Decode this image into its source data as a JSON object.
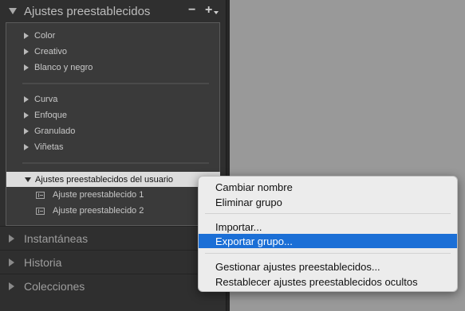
{
  "presets_panel": {
    "title": "Ajustes preestablecidos",
    "remove_label": "−",
    "add_label": "+",
    "group_a": [
      "Color",
      "Creativo",
      "Blanco y negro"
    ],
    "group_b": [
      "Curva",
      "Enfoque",
      "Granulado",
      "Viñetas"
    ],
    "user_folder": {
      "label": "Ajustes preestablecidos del usuario",
      "presets": [
        "Ajuste preestablecido 1",
        "Ajuste preestablecido 2"
      ]
    }
  },
  "sections": [
    "Instantáneas",
    "Historia",
    "Colecciones"
  ],
  "context_menu": {
    "items": [
      "Cambiar nombre",
      "Eliminar grupo",
      "Importar...",
      "Exportar grupo...",
      "Gestionar ajustes preestablecidos...",
      "Restablecer ajustes preestablecidos ocultos"
    ],
    "highlighted_item": "Exportar grupo..."
  },
  "colors": {
    "panel_bg": "#2f2f2f",
    "selection_bg": "#dcdcdc",
    "menu_bg": "#ececec",
    "menu_highlight": "#1b6fd6"
  }
}
